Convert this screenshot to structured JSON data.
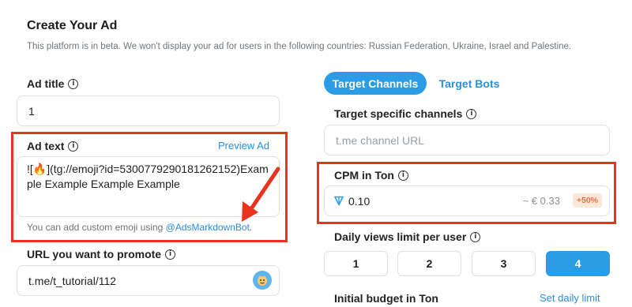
{
  "header": {
    "title": "Create Your Ad",
    "subtitle": "This platform is in beta. We won't display your ad for users in the following countries: Russian Federation, Ukraine, Israel and Palestine."
  },
  "ad_title": {
    "label": "Ad title",
    "value": "1"
  },
  "ad_text": {
    "label": "Ad text",
    "preview_link": "Preview Ad",
    "value": "![🔥](tg://emoji?id=5300779290181262152)Example Example Example Example",
    "hint_prefix": "You can add custom emoji using ",
    "hint_mention": "@AdsMarkdownBot",
    "hint_suffix": "."
  },
  "url": {
    "label": "URL you want to promote",
    "value": "t.me/t_tutorial/112"
  },
  "tabs": [
    {
      "label": "Target Channels",
      "active": true
    },
    {
      "label": "Target Bots",
      "active": false
    }
  ],
  "target_channels": {
    "label": "Target specific channels",
    "placeholder": "t.me channel URL"
  },
  "cpm": {
    "label": "CPM in Ton",
    "value": "0.10",
    "approx": "~ € 0.33",
    "badge": "+50%"
  },
  "daily_views": {
    "label": "Daily views limit per user",
    "options": [
      "1",
      "2",
      "3",
      "4"
    ],
    "selected": "4"
  },
  "budget": {
    "label": "Initial budget in Ton",
    "link": "Set daily limit"
  },
  "colors": {
    "accent": "#2a9de6",
    "highlight": "#e8331f",
    "badge_bg": "#fde8d8",
    "badge_text": "#e5704a"
  },
  "icons": [
    "info-icon",
    "ton-diamond-icon",
    "emoji-picker-icon",
    "red-arrow-annotation"
  ]
}
